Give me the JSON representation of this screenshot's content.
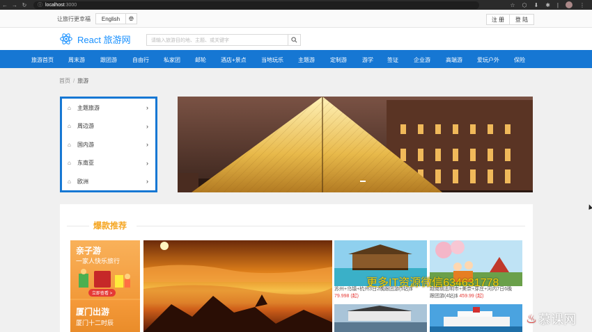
{
  "browser": {
    "url_host": "localhost",
    "url_port": ":3000"
  },
  "topbar": {
    "slogan": "让旅行更幸福",
    "language": "English",
    "register": "注 册",
    "login": "登 陆"
  },
  "header": {
    "logo_text": "React 旅游网",
    "search_placeholder": "请输入旅游目的地、主题、或关键字"
  },
  "nav": {
    "items": [
      "旅游首页",
      "周末游",
      "跟团游",
      "自由行",
      "私家团",
      "邮轮",
      "酒店+景点",
      "当地玩乐",
      "主题游",
      "定制游",
      "游学",
      "签证",
      "企业游",
      "高端游",
      "爱玩户外",
      "保险"
    ]
  },
  "breadcrumb": {
    "home": "首页",
    "current": "旅游"
  },
  "sidemenu": {
    "items": [
      "主题旅游",
      "周边游",
      "国内游",
      "东南亚",
      "欧洲"
    ]
  },
  "featured": {
    "title": "爆款推荐",
    "promo1_title": "亲子游",
    "promo1_sub": "一家人快乐旅行",
    "promo1_cta": "立即查看 >",
    "promo2_title": "厦门出游",
    "promo2_sub": "厦门十二时辰",
    "card1_desc": "苏州+乌镇+杭州3日2晚跟团游(5钻)$",
    "card1_price": "79.998 (起)",
    "card2_desc": "越南胡志明市+美奈+芽庄+河内7日6晚",
    "card2_price_prefix": "跟团游(4钻)$ ",
    "card2_price": "459.99 (起)"
  },
  "overlay": {
    "watermark": "更多IT资源微信634631778",
    "brand": "慕课网"
  },
  "colors": {
    "primary": "#1677d3",
    "accent": "#f5a623",
    "price": "#e53935"
  }
}
